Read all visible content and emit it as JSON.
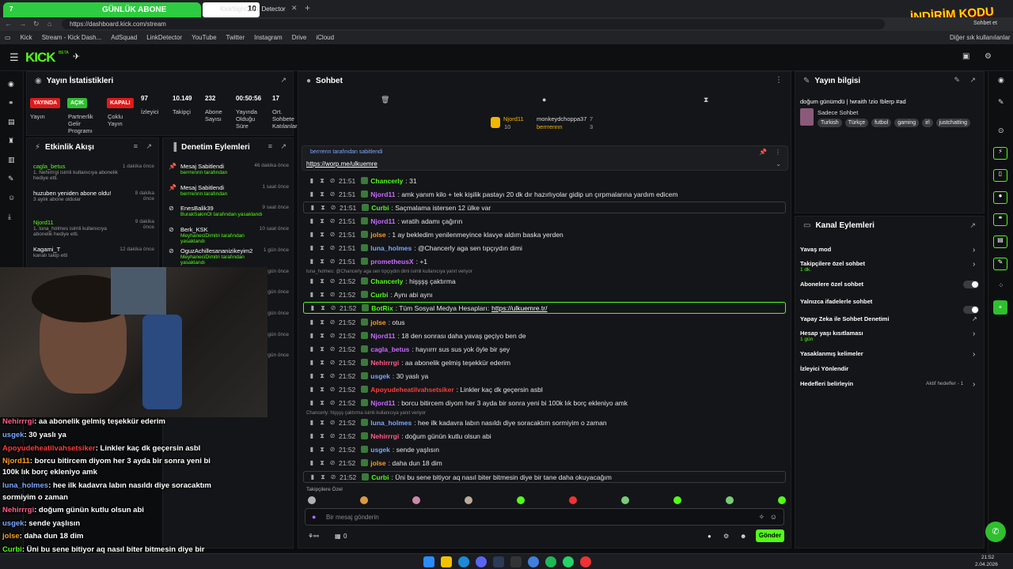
{
  "browser": {
    "tab_active_label": "GÜNLÜK ABONE",
    "tab_active_num": "7",
    "tab_count_badge": "10",
    "tab_second": "KickSight Link Detector",
    "url": "https://dashboard.kick.com/stream",
    "bookmarks": [
      "Kick",
      "Stream - Kick Dash...",
      "AdSquad",
      "LinkDetector",
      "YouTube",
      "Twitter",
      "Instagram",
      "Drive",
      "iCloud"
    ],
    "other_bookmarks": "Diğer sık kullanılanlar",
    "profile_action": "Sohbet et",
    "promo_overlay": "İNDİRİM KODU"
  },
  "nav": {
    "logo": "KICK",
    "logo_beta": "BETA"
  },
  "stats": {
    "title": "Yayın İstatistikleri",
    "tags": [
      {
        "label": "YAYINDA",
        "color": "#e01a1a",
        "caption": "Yayın"
      },
      {
        "label": "AÇIK",
        "color": "#2fbf2f",
        "caption": "Partnerlik Gelir Programı"
      },
      {
        "label": "KAPALI",
        "color": "#e01a1a",
        "caption": "Çoklu Yayın"
      }
    ],
    "values": [
      {
        "value": "97",
        "label": "İzleyici"
      },
      {
        "value": "10.149",
        "label": "Takipçi"
      },
      {
        "value": "232",
        "label": "Abone Sayısı"
      },
      {
        "value": "00:50:56",
        "label": "Yayında Olduğu Süre"
      },
      {
        "value": "17",
        "label": "Ort. Sohbete Katılanlar"
      }
    ]
  },
  "events": {
    "title": "Etkinlik Akışı",
    "items": [
      {
        "name": "cagla_betus",
        "sub": "1. Nehirrrgi isimli kullanıcıya abonelik hediye etti.",
        "time": "1 dakika önce"
      },
      {
        "name": "huzuben yeniden abone oldu!",
        "sub": "3 aylık abone oldular",
        "time": "8 dakika önce"
      },
      {
        "name": "Njord11",
        "sub": "1. luna_holmes isimli kullanıcıya abonelik hediye etti.",
        "time": "9 dakika önce"
      },
      {
        "name": "Kagami_T",
        "sub": "kanalı takip etti",
        "time": "12 dakika önce"
      }
    ]
  },
  "moderation": {
    "title": "Denetim Eylemleri",
    "items": [
      {
        "name": "Mesaj Sabitlendi",
        "sub": "berrrennn tarafından",
        "time": "46 dakika önce"
      },
      {
        "name": "Mesaj Sabitlendi",
        "sub": "berrrennn tarafından",
        "time": "1 saat önce"
      },
      {
        "name": "EnesBalik39",
        "sub": "BurakSakinOl tarafından yasaklandı",
        "time": "9 saat önce"
      },
      {
        "name": "Berk_KSK",
        "sub": "MeyhaneciDimitri tarafından yasaklandı",
        "time": "10 saat önce"
      },
      {
        "name": "OguzAchillesananizikeyim2",
        "sub": "MeyhaneciDimitri tarafından yasaklandı",
        "time": "1 gün önce"
      },
      {
        "name": "skirtel53",
        "sub": "berrrennn tarafından yasağı kaldırıldı",
        "time": "1 gün önce"
      },
      {
        "name": "usgek",
        "sub": "berrrennn tarafından yasağı kaldırıldı",
        "time": "1 gün önce"
      },
      {
        "name": "Mesaj Sabitlendi",
        "sub": "UlkuEmre tarafından",
        "time": "1 gün önce"
      },
      {
        "name": "61Trabzon61birdaha61",
        "sub": "BurakSakinOl tarafından yasaklandı",
        "time": "1 gün önce"
      },
      {
        "name": "Miss_turkiye_juri",
        "sub": "BurakSakinOl tarafından yasaklandı",
        "time": "1 gün önce"
      }
    ]
  },
  "chat": {
    "title": "Sohbet",
    "top_gifters": [
      {
        "name": "Njord11",
        "count": "10"
      },
      {
        "name": "monkeydchoppa37",
        "count": "7"
      },
      {
        "name": "berrrennn",
        "count": "3"
      }
    ],
    "pinned": {
      "by": "berrrenn tarafından sabitlendi",
      "link": "https://worp.me/ulkuemre"
    },
    "reply_notes": [
      "luna_holmes: @Chancerly aga sen tıpçıydın dimi isimli kullanıcıya yanıt veriyor",
      "Chancerly: hişşşş çaktırma isimli kullanıcıya yanıt veriyor"
    ],
    "messages": [
      {
        "time": "21:51",
        "user": "Chancerly",
        "color": "#53fc18",
        "text": ": 31"
      },
      {
        "time": "21:51",
        "user": "Njord11",
        "color": "#c86bff",
        "text": ": amk yanım kilo  + tek kişilik pastayı 20 dk dır hazırlıyolar gidip un çırpmalarına yardım edicem"
      },
      {
        "time": "21:51",
        "user": "Curbi",
        "color": "#53fc18",
        "text": ": Saçmalama istersen 12 ülke var"
      },
      {
        "time": "21:51",
        "user": "Njord11",
        "color": "#c86bff",
        "text": ": wratih adamı çağırın"
      },
      {
        "time": "21:51",
        "user": "jolse",
        "color": "#ff9f1c",
        "text": ": 1 ay bekledim yenilenmeyince klavye aldım baska yerden"
      },
      {
        "time": "21:51",
        "user": "luna_holmes",
        "color": "#7aa7ff",
        "text": ": @Chancerly aga sen tıpçıydın dimi"
      },
      {
        "time": "21:51",
        "user": "prometheusX",
        "color": "#c86bff",
        "text": ": +1"
      },
      {
        "time": "21:52",
        "user": "Chancerly",
        "color": "#53fc18",
        "text": ": hişşşş çaktırma"
      },
      {
        "time": "21:52",
        "user": "Curbi",
        "color": "#53fc18",
        "text": ": Aynı abi aynı"
      },
      {
        "time": "21:52",
        "user": "BotRix",
        "color": "#53fc18",
        "text": ": Tüm Sosyal Medya Hesapları: ",
        "link": "https://ulkuemre.tr/"
      },
      {
        "time": "21:52",
        "user": "jolse",
        "color": "#ff9f1c",
        "text": ": otus"
      },
      {
        "time": "21:52",
        "user": "Njord11",
        "color": "#c86bff",
        "text": ": 18 den sonrası daha yavaş geçiyo ben de"
      },
      {
        "time": "21:52",
        "user": "cagla_betus",
        "color": "#c86bff",
        "text": ": hayıırrr sus sus yok öyle bir şey"
      },
      {
        "time": "21:52",
        "user": "Nehirrrgi",
        "color": "#ff5c8a",
        "text": ": aa abonelik gelmiş teşekkür ederim"
      },
      {
        "time": "21:52",
        "user": "usgek",
        "color": "#7aa7ff",
        "text": ": 30 yaslı ya"
      },
      {
        "time": "21:52",
        "user": "Apoyudeheatilvahsetsiker",
        "color": "#ff3b3b",
        "text": ": Linkler kaç dk geçersin asbl"
      },
      {
        "time": "21:52",
        "user": "Njord11",
        "color": "#c86bff",
        "text": ": borcu bitircem diyom her 3 ayda bir sonra yeni bi 100k lık borç ekleniyo amk"
      },
      {
        "time": "21:52",
        "user": "luna_holmes",
        "color": "#7aa7ff",
        "text": ": hee ilk kadavra labın nasıldı diye soracaktım sormiyim o zaman"
      },
      {
        "time": "21:52",
        "user": "Nehirrrgi",
        "color": "#ff5c8a",
        "text": ": doğum günün kutlu olsun abi"
      },
      {
        "time": "21:52",
        "user": "usgek",
        "color": "#7aa7ff",
        "text": ": sende yaşlısın"
      },
      {
        "time": "21:52",
        "user": "jolse",
        "color": "#ff9f1c",
        "text": ": daha dun 18 dim"
      },
      {
        "time": "21:52",
        "user": "Curbi",
        "color": "#53fc18",
        "text": ": Üni bu sene bitiyor aq nasıl biter bitmesin diye bir tane daha okuyacağım"
      }
    ],
    "followers_only": "Takipçilere Özel",
    "input_placeholder": "Bir mesaj gönderin",
    "send_label": "Gönder",
    "counter": "0"
  },
  "stream_info": {
    "title": "Yayın bilgisi",
    "stream_title": "doğum günümdü | !wraith !zio !blerp #ad",
    "category": "Sadece Sohbet",
    "tags": [
      "Turkish",
      "Türkçe",
      "futbol",
      "gaming",
      "irl",
      "justchatting"
    ]
  },
  "channel_actions": {
    "title": "Kanal Eylemleri",
    "items": [
      {
        "label": "Yavaş mod",
        "sub": "",
        "control": "chevron"
      },
      {
        "label": "Takipçilere özel sohbet",
        "sub": "1 dk.",
        "control": "chevron"
      },
      {
        "label": "Abonelere özel sohbet",
        "sub": "",
        "control": "toggle"
      },
      {
        "label": "Yalnızca ifadelerle sohbet",
        "sub": "",
        "control": "toggle"
      },
      {
        "label": "Yapay Zeka ile Sohbet Denetimi",
        "sub": "",
        "control": "external"
      },
      {
        "label": "Hesap yaşı kısıtlaması",
        "sub": "1 gün",
        "control": "chevron"
      },
      {
        "label": "Yasaklanmış kelimeler",
        "sub": "",
        "control": "chevron"
      },
      {
        "label": "İzleyici Yönlendir",
        "sub": "",
        "control": "none"
      },
      {
        "label": "Hedefleri belirleyin",
        "sub": "",
        "control": "chevron",
        "right": "Aktif hedefler - 1"
      }
    ]
  },
  "overlay_chat": [
    {
      "user": "Nehirrrgi",
      "color": "#ff5c8a",
      "text": ": aa abonelik gelmiş teşekkür ederim"
    },
    {
      "user": "usgek",
      "color": "#7aa7ff",
      "text": ": 30 yaslı ya"
    },
    {
      "user": "Apoyudeheatilvahsetsiker",
      "color": "#ff3b3b",
      "text": ": Linkler kaç dk geçersin asbl"
    },
    {
      "user": "Njord11",
      "color": "#ff9f1c",
      "text": ": borcu bitircem diyom her 3 ayda bir sonra yeni bi"
    },
    {
      "user": "",
      "color": "#fff",
      "text": "100k lık borç ekleniyo amk"
    },
    {
      "user": "luna_holmes",
      "color": "#7aa7ff",
      "text": ": hee ilk kadavra labın nasıldı diye soracaktım"
    },
    {
      "user": "",
      "color": "#fff",
      "text": "sormiyim o zaman"
    },
    {
      "user": "Nehirrrgi",
      "color": "#ff5c8a",
      "text": ": doğum günün kutlu olsun abi"
    },
    {
      "user": "usgek",
      "color": "#7aa7ff",
      "text": ": sende yaşlısın"
    },
    {
      "user": "jolse",
      "color": "#ff9f1c",
      "text": ": daha dun 18 dim"
    },
    {
      "user": "Curbi",
      "color": "#53fc18",
      "text": ": Üni bu sene bitiyor aq nasıl biter bitmesin diye bir"
    },
    {
      "user": "",
      "color": "#fff",
      "text": "tane daha okuyacağım"
    }
  ],
  "taskbar": {
    "time": "21:52",
    "date": "2.04.2026"
  }
}
